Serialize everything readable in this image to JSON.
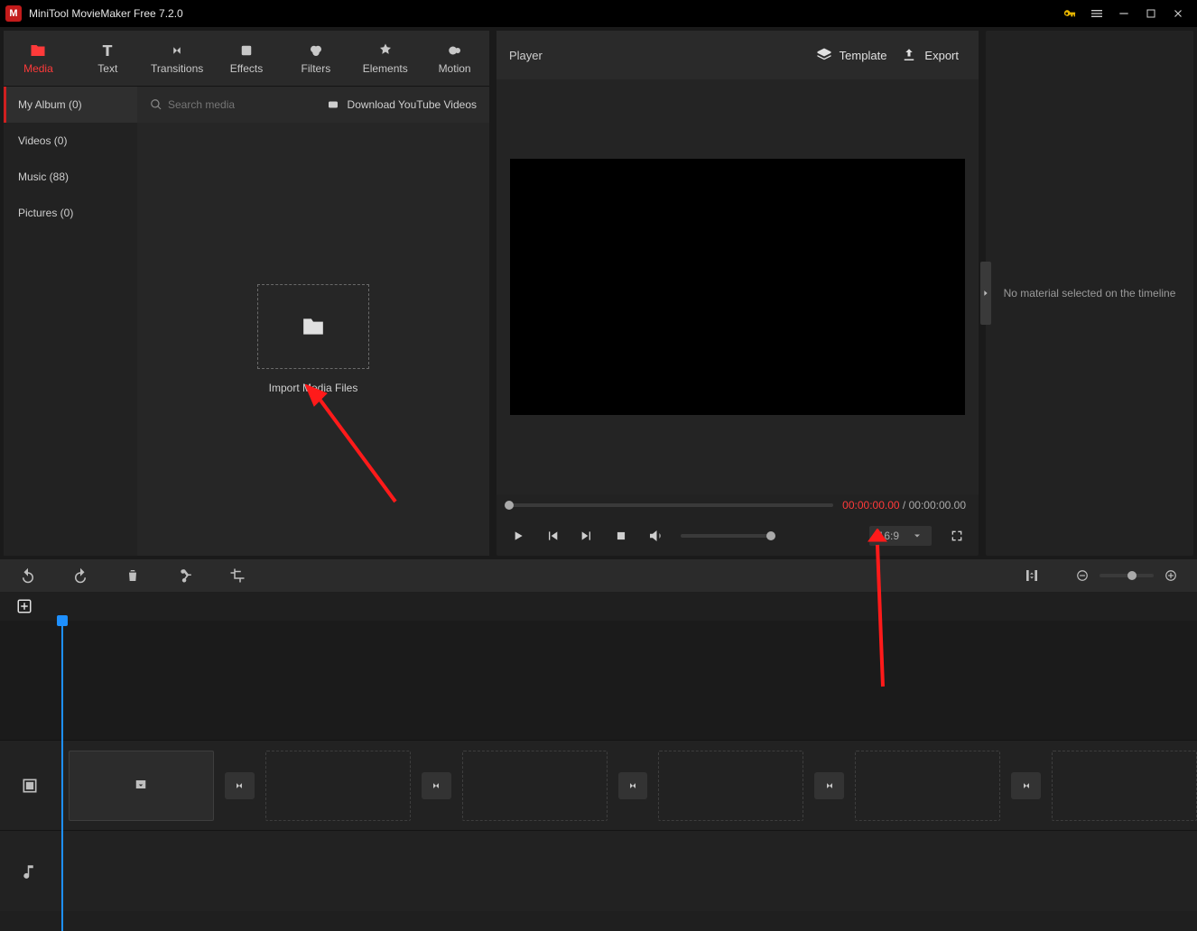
{
  "titlebar": {
    "title": "MiniTool MovieMaker Free 7.2.0"
  },
  "toptabs": {
    "media": "Media",
    "text": "Text",
    "transitions": "Transitions",
    "effects": "Effects",
    "filters": "Filters",
    "elements": "Elements",
    "motion": "Motion"
  },
  "sidebar": {
    "myalbum": "My Album (0)",
    "videos": "Videos (0)",
    "music": "Music (88)",
    "pictures": "Pictures (0)"
  },
  "mediabar": {
    "search_placeholder": "Search media",
    "download": "Download YouTube Videos"
  },
  "import": {
    "label": "Import Media Files"
  },
  "player": {
    "title": "Player",
    "template": "Template",
    "export": "Export",
    "time_current": "00:00:00.00",
    "time_sep": " / ",
    "time_total": "00:00:00.00",
    "ratio": "16:9"
  },
  "rightpanel": {
    "message": "No material selected on the timeline"
  }
}
